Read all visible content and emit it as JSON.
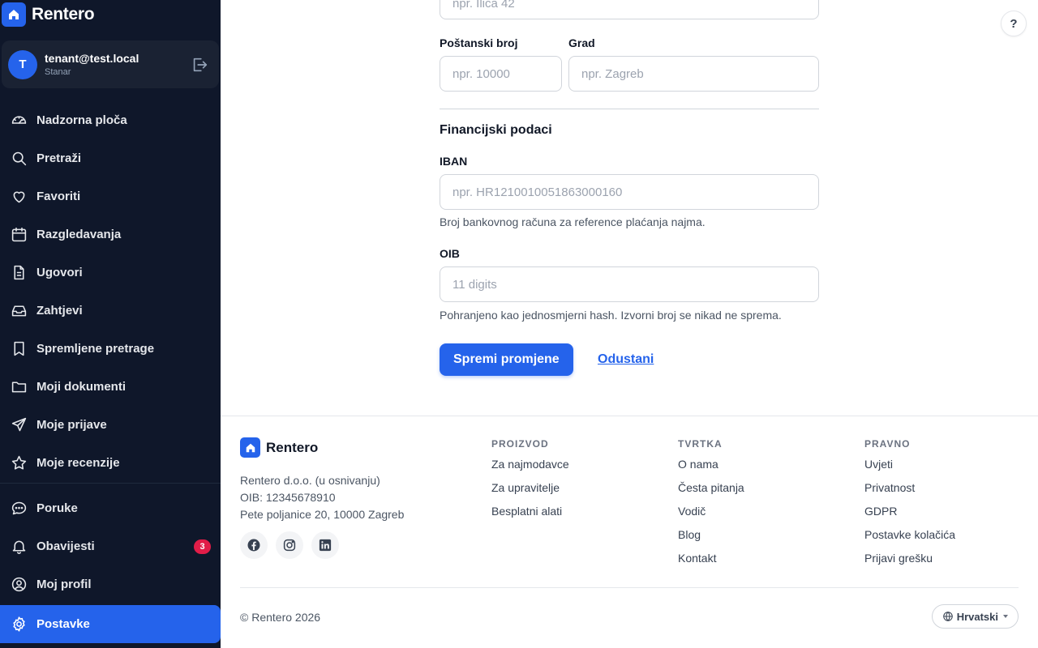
{
  "app": {
    "brand": "Rentero"
  },
  "user": {
    "initial": "T",
    "email": "tenant@test.local",
    "role": "Stanar"
  },
  "nav": {
    "items": [
      {
        "label": "Nadzorna ploča",
        "icon": "dashboard-icon"
      },
      {
        "label": "Pretraži",
        "icon": "search-icon"
      },
      {
        "label": "Favoriti",
        "icon": "heart-icon"
      },
      {
        "label": "Razgledavanja",
        "icon": "calendar-icon"
      },
      {
        "label": "Ugovori",
        "icon": "document-icon"
      },
      {
        "label": "Zahtjevi",
        "icon": "inbox-icon"
      },
      {
        "label": "Spremljene pretrage",
        "icon": "bookmark-icon"
      },
      {
        "label": "Moji dokumenti",
        "icon": "folder-icon"
      },
      {
        "label": "Moje prijave",
        "icon": "send-icon"
      },
      {
        "label": "Moje recenzije",
        "icon": "star-icon"
      }
    ],
    "secondary": [
      {
        "label": "Poruke",
        "icon": "chat-icon"
      },
      {
        "label": "Obavijesti",
        "icon": "bell-icon",
        "badge": "3"
      },
      {
        "label": "Moj profil",
        "icon": "user-circle-icon"
      },
      {
        "label": "Postavke",
        "icon": "gear-icon",
        "active": true
      }
    ]
  },
  "form": {
    "street_placeholder": "npr. Ilica 42",
    "postal_label": "Poštanski broj",
    "postal_placeholder": "npr. 10000",
    "city_label": "Grad",
    "city_placeholder": "npr. Zagreb",
    "financial_title": "Financijski podaci",
    "iban_label": "IBAN",
    "iban_placeholder": "npr. HR1210010051863000160",
    "iban_hint": "Broj bankovnog računa za reference plaćanja najma.",
    "oib_label": "OIB",
    "oib_placeholder": "11 digits",
    "oib_hint": "Pohranjeno kao jednosmjerni hash. Izvorni broj se nikad ne sprema.",
    "save_label": "Spremi promjene",
    "cancel_label": "Odustani"
  },
  "help": {
    "label": "?"
  },
  "footer": {
    "brand": "Rentero",
    "company_name": "Rentero d.o.o. (u osnivanju)",
    "company_oib": "OIB: 12345678910",
    "company_address": "Pete poljanice 20, 10000 Zagreb",
    "columns": [
      {
        "title": "PROIZVOD",
        "links": [
          "Za najmodavce",
          "Za upravitelje",
          "Besplatni alati"
        ]
      },
      {
        "title": "TVRTKA",
        "links": [
          "O nama",
          "Česta pitanja",
          "Vodič",
          "Blog",
          "Kontakt"
        ]
      },
      {
        "title": "PRAVNO",
        "links": [
          "Uvjeti",
          "Privatnost",
          "GDPR",
          "Postavke kolačića",
          "Prijavi grešku"
        ]
      }
    ],
    "copyright": "© Rentero 2026",
    "language": "Hrvatski"
  },
  "colors": {
    "sidebar_bg": "#0f172a",
    "accent": "#2563eb",
    "badge": "#e11d48"
  }
}
